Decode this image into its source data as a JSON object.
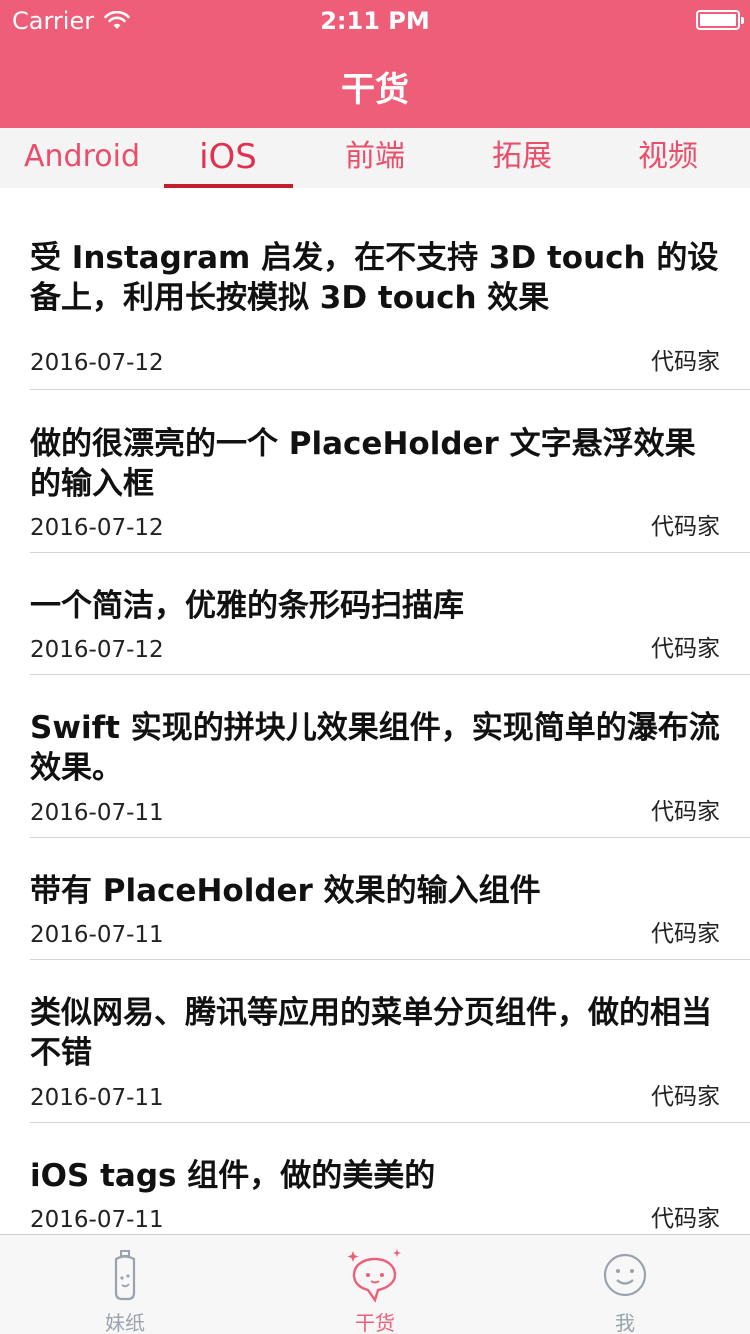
{
  "status_bar": {
    "carrier": "Carrier",
    "time": "2:11 PM",
    "wifi_icon": "wifi-icon",
    "battery_icon": "battery-icon"
  },
  "nav": {
    "title": "干货",
    "background": "#ef5e78"
  },
  "tabs": [
    {
      "label": "Android",
      "active": false
    },
    {
      "label": "iOS",
      "active": true
    },
    {
      "label": "前端",
      "active": false
    },
    {
      "label": "拓展",
      "active": false
    },
    {
      "label": "视频",
      "active": false
    }
  ],
  "articles": [
    {
      "title": "受 Instagram 启发，在不支持 3D touch 的设备上，利用长按模拟 3D touch 效果",
      "date": "2016-07-12",
      "author": "代码家"
    },
    {
      "title": "做的很漂亮的一个 PlaceHolder 文字悬浮效果的输入框",
      "date": "2016-07-12",
      "author": "代码家"
    },
    {
      "title": "一个简洁，优雅的条形码扫描库",
      "date": "2016-07-12",
      "author": "代码家"
    },
    {
      "title": "Swift 实现的拼块儿效果组件，实现简单的瀑布流效果。",
      "date": "2016-07-11",
      "author": "代码家"
    },
    {
      "title": "带有 PlaceHolder 效果的输入组件",
      "date": "2016-07-11",
      "author": "代码家"
    },
    {
      "title": "类似网易、腾讯等应用的菜单分页组件，做的相当不错",
      "date": "2016-07-11",
      "author": "代码家"
    },
    {
      "title": "iOS tags 组件，做的美美的",
      "date": "2016-07-11",
      "author": "代码家"
    }
  ],
  "tabbar": {
    "items": [
      {
        "label": "妹纸",
        "icon": "baby-bottle-icon",
        "active": false
      },
      {
        "label": "干货",
        "icon": "chat-bubble-icon",
        "active": true
      },
      {
        "label": "我",
        "icon": "smiley-face-icon",
        "active": false
      }
    ],
    "active_color": "#ef5e78",
    "inactive_color": "#9aa3ad"
  }
}
